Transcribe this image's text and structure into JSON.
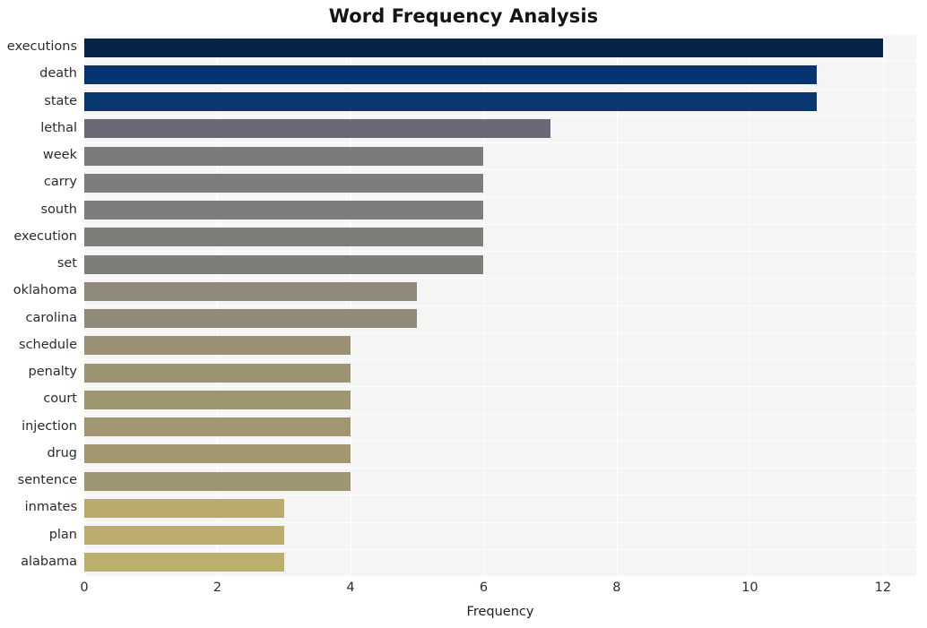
{
  "chart_data": {
    "type": "bar",
    "orientation": "horizontal",
    "title": "Word Frequency Analysis",
    "xlabel": "Frequency",
    "ylabel": "",
    "xlim": [
      0,
      12.5
    ],
    "xticks": [
      0,
      2,
      4,
      6,
      8,
      10,
      12
    ],
    "xticklabels": [
      "0",
      "2",
      "4",
      "6",
      "8",
      "10",
      "12"
    ],
    "grid": true,
    "legend": null,
    "categories": [
      "executions",
      "death",
      "state",
      "lethal",
      "week",
      "carry",
      "south",
      "execution",
      "set",
      "oklahoma",
      "carolina",
      "schedule",
      "penalty",
      "court",
      "injection",
      "drug",
      "sentence",
      "inmates",
      "plan",
      "alabama"
    ],
    "values": [
      12,
      11,
      11,
      7,
      6,
      6,
      6,
      6,
      6,
      5,
      5,
      4,
      4,
      4,
      4,
      4,
      4,
      3,
      3,
      3
    ],
    "bar_colors": [
      "#052448",
      "#073470",
      "#08386f",
      "#6a6a76",
      "#7b7b7b",
      "#7d7d7c",
      "#7d7d7b",
      "#7e7d7a",
      "#7e7d79",
      "#91897a",
      "#918a79",
      "#9a9173",
      "#9c9372",
      "#9e9571",
      "#a09671",
      "#a29870",
      "#9e9670",
      "#b9ab6d",
      "#bbad6d",
      "#bcae6d"
    ],
    "plot_background": "#f5f5f6",
    "grid_color": "#ffffff",
    "figure_background": "#ffffff",
    "title_color": "#141414"
  }
}
